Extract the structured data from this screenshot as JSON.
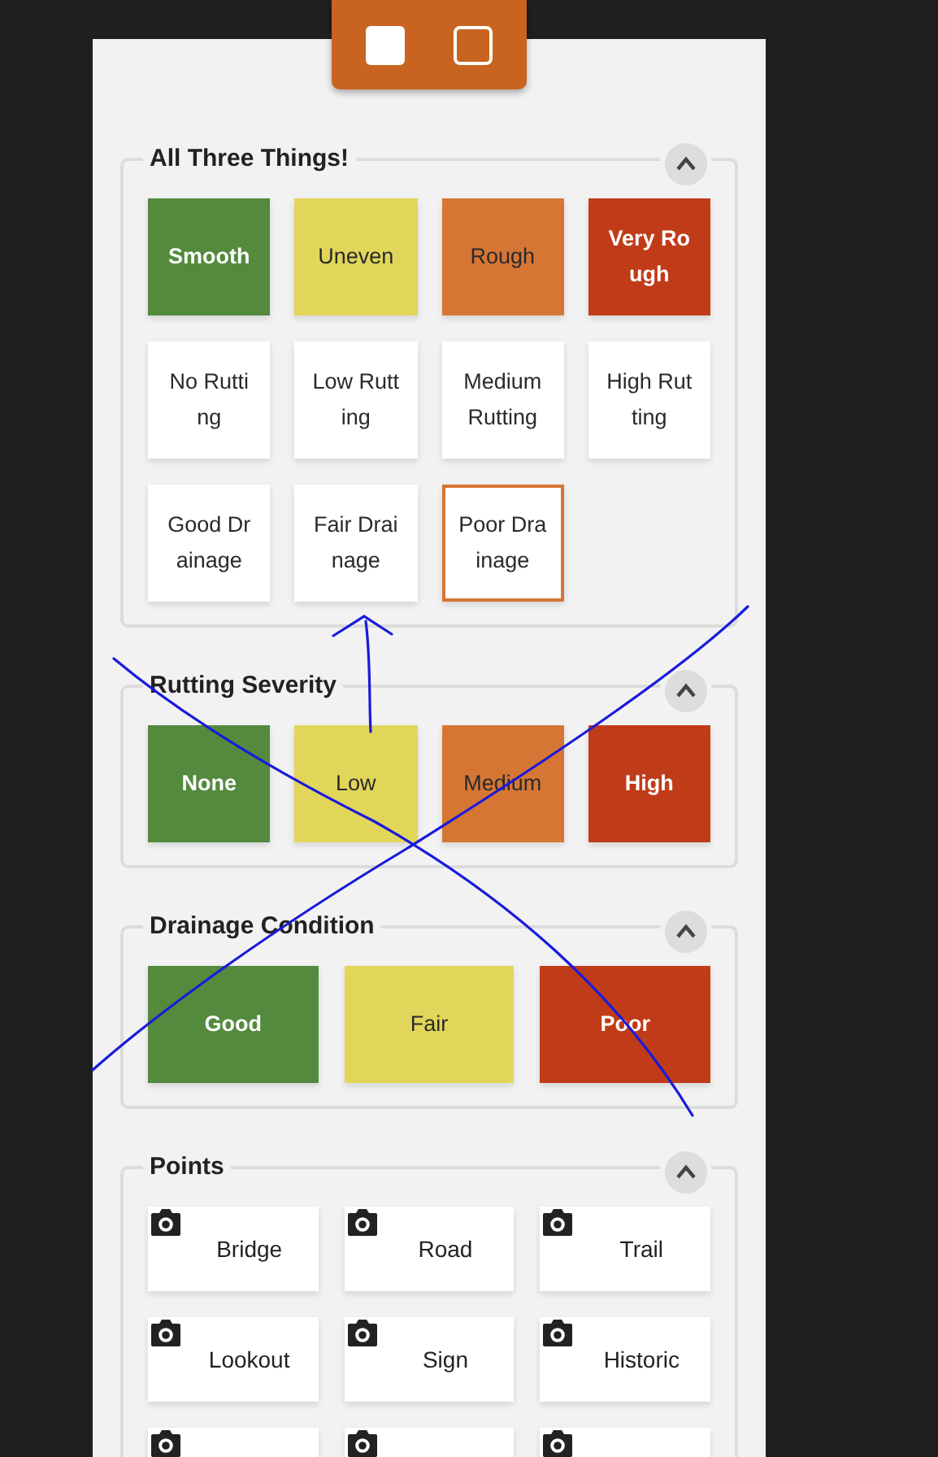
{
  "sections": [
    {
      "kind": "choices",
      "title": "All Three Things!",
      "expanded": true,
      "items": [
        {
          "label": "Smooth",
          "color": "#538a3e",
          "selected": false
        },
        {
          "label": "Uneven",
          "color": "#e1d65a",
          "selected": false
        },
        {
          "label": "Rough",
          "color": "#d67634",
          "selected": false
        },
        {
          "label": "Very Rough",
          "color": "#c03c18",
          "selected": false
        },
        {
          "label": "No Rutting",
          "selected": false
        },
        {
          "label": "Low Rutting",
          "selected": false
        },
        {
          "label": "Medium Rutting",
          "selected": false
        },
        {
          "label": "High Rutting",
          "selected": false
        },
        {
          "label": "Good Drainage",
          "selected": false
        },
        {
          "label": "Fair Drainage",
          "selected": false
        },
        {
          "label": "Poor Drainage",
          "selected": true
        }
      ]
    },
    {
      "kind": "choices",
      "title": "Rutting Severity",
      "expanded": true,
      "items": [
        {
          "label": "None",
          "color": "#538a3e",
          "selected": false
        },
        {
          "label": "Low",
          "color": "#e1d65a",
          "selected": false
        },
        {
          "label": "Medium",
          "color": "#d67634",
          "selected": false
        },
        {
          "label": "High",
          "color": "#c03c18",
          "selected": false
        }
      ]
    },
    {
      "kind": "choices",
      "title": "Drainage Condition",
      "expanded": true,
      "items": [
        {
          "label": "Good",
          "color": "#538a3e",
          "selected": false
        },
        {
          "label": "Fair",
          "color": "#e1d65a",
          "selected": false
        },
        {
          "label": "Poor",
          "color": "#c03c18",
          "selected": false
        }
      ]
    },
    {
      "kind": "points",
      "title": "Points",
      "expanded": true,
      "items": [
        {
          "kind": "labeled",
          "label": "Bridge"
        },
        {
          "kind": "labeled",
          "label": "Road"
        },
        {
          "kind": "labeled",
          "label": "Trail"
        },
        {
          "kind": "labeled",
          "label": "Lookout"
        },
        {
          "kind": "labeled",
          "label": "Sign"
        },
        {
          "kind": "labeled",
          "label": "Historic"
        },
        {
          "kind": "unlabeled"
        },
        {
          "kind": "unlabeled"
        },
        {
          "kind": "unlabeled"
        }
      ]
    }
  ]
}
